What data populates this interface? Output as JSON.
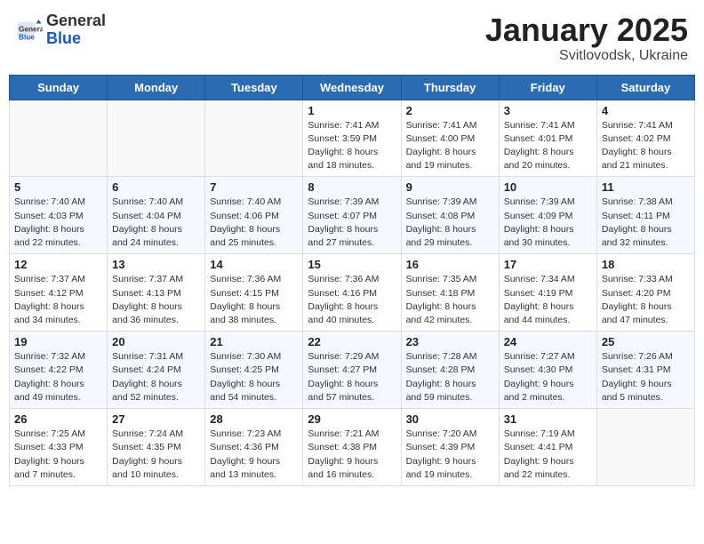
{
  "header": {
    "logo": {
      "general": "General",
      "blue": "Blue"
    },
    "title": "January 2025",
    "subtitle": "Svitlovodsk, Ukraine"
  },
  "weekdays": [
    "Sunday",
    "Monday",
    "Tuesday",
    "Wednesday",
    "Thursday",
    "Friday",
    "Saturday"
  ],
  "weeks": [
    [
      {
        "day": "",
        "sunrise": "",
        "sunset": "",
        "daylight": ""
      },
      {
        "day": "",
        "sunrise": "",
        "sunset": "",
        "daylight": ""
      },
      {
        "day": "",
        "sunrise": "",
        "sunset": "",
        "daylight": ""
      },
      {
        "day": "1",
        "sunrise": "Sunrise: 7:41 AM",
        "sunset": "Sunset: 3:59 PM",
        "daylight": "Daylight: 8 hours and 18 minutes."
      },
      {
        "day": "2",
        "sunrise": "Sunrise: 7:41 AM",
        "sunset": "Sunset: 4:00 PM",
        "daylight": "Daylight: 8 hours and 19 minutes."
      },
      {
        "day": "3",
        "sunrise": "Sunrise: 7:41 AM",
        "sunset": "Sunset: 4:01 PM",
        "daylight": "Daylight: 8 hours and 20 minutes."
      },
      {
        "day": "4",
        "sunrise": "Sunrise: 7:41 AM",
        "sunset": "Sunset: 4:02 PM",
        "daylight": "Daylight: 8 hours and 21 minutes."
      }
    ],
    [
      {
        "day": "5",
        "sunrise": "Sunrise: 7:40 AM",
        "sunset": "Sunset: 4:03 PM",
        "daylight": "Daylight: 8 hours and 22 minutes."
      },
      {
        "day": "6",
        "sunrise": "Sunrise: 7:40 AM",
        "sunset": "Sunset: 4:04 PM",
        "daylight": "Daylight: 8 hours and 24 minutes."
      },
      {
        "day": "7",
        "sunrise": "Sunrise: 7:40 AM",
        "sunset": "Sunset: 4:06 PM",
        "daylight": "Daylight: 8 hours and 25 minutes."
      },
      {
        "day": "8",
        "sunrise": "Sunrise: 7:39 AM",
        "sunset": "Sunset: 4:07 PM",
        "daylight": "Daylight: 8 hours and 27 minutes."
      },
      {
        "day": "9",
        "sunrise": "Sunrise: 7:39 AM",
        "sunset": "Sunset: 4:08 PM",
        "daylight": "Daylight: 8 hours and 29 minutes."
      },
      {
        "day": "10",
        "sunrise": "Sunrise: 7:39 AM",
        "sunset": "Sunset: 4:09 PM",
        "daylight": "Daylight: 8 hours and 30 minutes."
      },
      {
        "day": "11",
        "sunrise": "Sunrise: 7:38 AM",
        "sunset": "Sunset: 4:11 PM",
        "daylight": "Daylight: 8 hours and 32 minutes."
      }
    ],
    [
      {
        "day": "12",
        "sunrise": "Sunrise: 7:37 AM",
        "sunset": "Sunset: 4:12 PM",
        "daylight": "Daylight: 8 hours and 34 minutes."
      },
      {
        "day": "13",
        "sunrise": "Sunrise: 7:37 AM",
        "sunset": "Sunset: 4:13 PM",
        "daylight": "Daylight: 8 hours and 36 minutes."
      },
      {
        "day": "14",
        "sunrise": "Sunrise: 7:36 AM",
        "sunset": "Sunset: 4:15 PM",
        "daylight": "Daylight: 8 hours and 38 minutes."
      },
      {
        "day": "15",
        "sunrise": "Sunrise: 7:36 AM",
        "sunset": "Sunset: 4:16 PM",
        "daylight": "Daylight: 8 hours and 40 minutes."
      },
      {
        "day": "16",
        "sunrise": "Sunrise: 7:35 AM",
        "sunset": "Sunset: 4:18 PM",
        "daylight": "Daylight: 8 hours and 42 minutes."
      },
      {
        "day": "17",
        "sunrise": "Sunrise: 7:34 AM",
        "sunset": "Sunset: 4:19 PM",
        "daylight": "Daylight: 8 hours and 44 minutes."
      },
      {
        "day": "18",
        "sunrise": "Sunrise: 7:33 AM",
        "sunset": "Sunset: 4:20 PM",
        "daylight": "Daylight: 8 hours and 47 minutes."
      }
    ],
    [
      {
        "day": "19",
        "sunrise": "Sunrise: 7:32 AM",
        "sunset": "Sunset: 4:22 PM",
        "daylight": "Daylight: 8 hours and 49 minutes."
      },
      {
        "day": "20",
        "sunrise": "Sunrise: 7:31 AM",
        "sunset": "Sunset: 4:24 PM",
        "daylight": "Daylight: 8 hours and 52 minutes."
      },
      {
        "day": "21",
        "sunrise": "Sunrise: 7:30 AM",
        "sunset": "Sunset: 4:25 PM",
        "daylight": "Daylight: 8 hours and 54 minutes."
      },
      {
        "day": "22",
        "sunrise": "Sunrise: 7:29 AM",
        "sunset": "Sunset: 4:27 PM",
        "daylight": "Daylight: 8 hours and 57 minutes."
      },
      {
        "day": "23",
        "sunrise": "Sunrise: 7:28 AM",
        "sunset": "Sunset: 4:28 PM",
        "daylight": "Daylight: 8 hours and 59 minutes."
      },
      {
        "day": "24",
        "sunrise": "Sunrise: 7:27 AM",
        "sunset": "Sunset: 4:30 PM",
        "daylight": "Daylight: 9 hours and 2 minutes."
      },
      {
        "day": "25",
        "sunrise": "Sunrise: 7:26 AM",
        "sunset": "Sunset: 4:31 PM",
        "daylight": "Daylight: 9 hours and 5 minutes."
      }
    ],
    [
      {
        "day": "26",
        "sunrise": "Sunrise: 7:25 AM",
        "sunset": "Sunset: 4:33 PM",
        "daylight": "Daylight: 9 hours and 7 minutes."
      },
      {
        "day": "27",
        "sunrise": "Sunrise: 7:24 AM",
        "sunset": "Sunset: 4:35 PM",
        "daylight": "Daylight: 9 hours and 10 minutes."
      },
      {
        "day": "28",
        "sunrise": "Sunrise: 7:23 AM",
        "sunset": "Sunset: 4:36 PM",
        "daylight": "Daylight: 9 hours and 13 minutes."
      },
      {
        "day": "29",
        "sunrise": "Sunrise: 7:21 AM",
        "sunset": "Sunset: 4:38 PM",
        "daylight": "Daylight: 9 hours and 16 minutes."
      },
      {
        "day": "30",
        "sunrise": "Sunrise: 7:20 AM",
        "sunset": "Sunset: 4:39 PM",
        "daylight": "Daylight: 9 hours and 19 minutes."
      },
      {
        "day": "31",
        "sunrise": "Sunrise: 7:19 AM",
        "sunset": "Sunset: 4:41 PM",
        "daylight": "Daylight: 9 hours and 22 minutes."
      },
      {
        "day": "",
        "sunrise": "",
        "sunset": "",
        "daylight": ""
      }
    ]
  ]
}
